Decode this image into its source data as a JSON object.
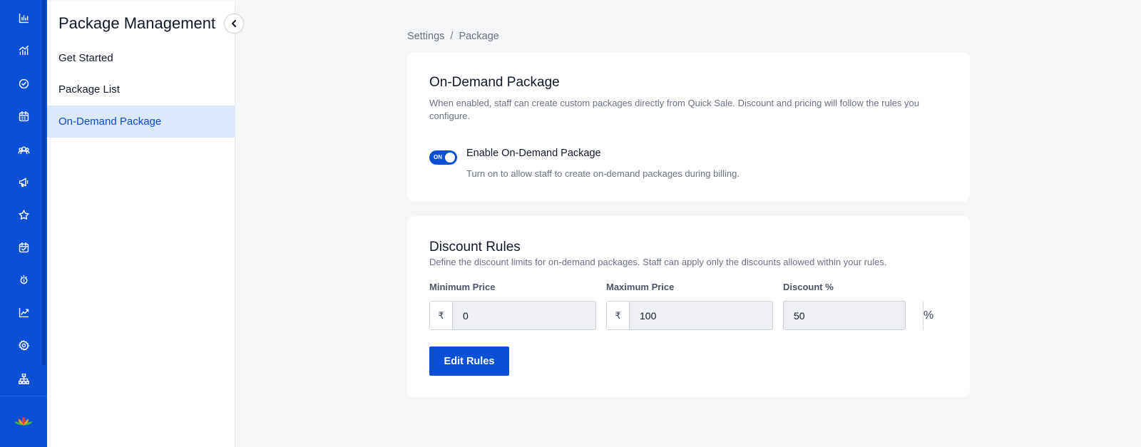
{
  "rail": {
    "icons": [
      "dashboard-chart-icon",
      "analytics-icon",
      "check-circle-icon",
      "calendar-icon",
      "clients-group-icon",
      "megaphone-icon",
      "star-icon",
      "calendar-check-icon",
      "loyalty-icon",
      "growth-chart-icon",
      "settings-gear-icon",
      "org-hierarchy-icon"
    ],
    "logo": "lotus-logo-icon",
    "color": "#0b4fd6"
  },
  "subnav": {
    "title": "Package Management",
    "items": [
      {
        "label": "Get Started"
      },
      {
        "label": "Package List"
      },
      {
        "label": "On-Demand Package",
        "active": true
      }
    ]
  },
  "breadcrumb": {
    "items": [
      "Settings",
      "Package"
    ],
    "separator": "/"
  },
  "on_demand": {
    "title": "On-Demand Package",
    "description": "When enabled, staff can create custom packages directly from Quick Sale. Discount and pricing will follow the rules you configure.",
    "toggle": {
      "state_text": "ON",
      "enabled": true,
      "label": "Enable On-Demand Package",
      "help": "Turn on to allow staff to create on-demand packages during billing."
    }
  },
  "discount_rules": {
    "title": "Discount Rules",
    "description": "Define the discount limits for on-demand packages. Staff can apply only the discounts allowed within your rules.",
    "fields": {
      "min_price": {
        "label": "Minimum Price",
        "prefix": "₹",
        "value": "0"
      },
      "max_price": {
        "label": "Maximum Price",
        "prefix": "₹",
        "value": "100"
      },
      "discount": {
        "label": "Discount %",
        "suffix": "%",
        "value": "50"
      }
    },
    "edit_button": "Edit Rules"
  },
  "colors": {
    "accent": "#0b4fd6",
    "active_nav_bg": "#dbe7fb",
    "page_bg": "#f5f6f8"
  }
}
